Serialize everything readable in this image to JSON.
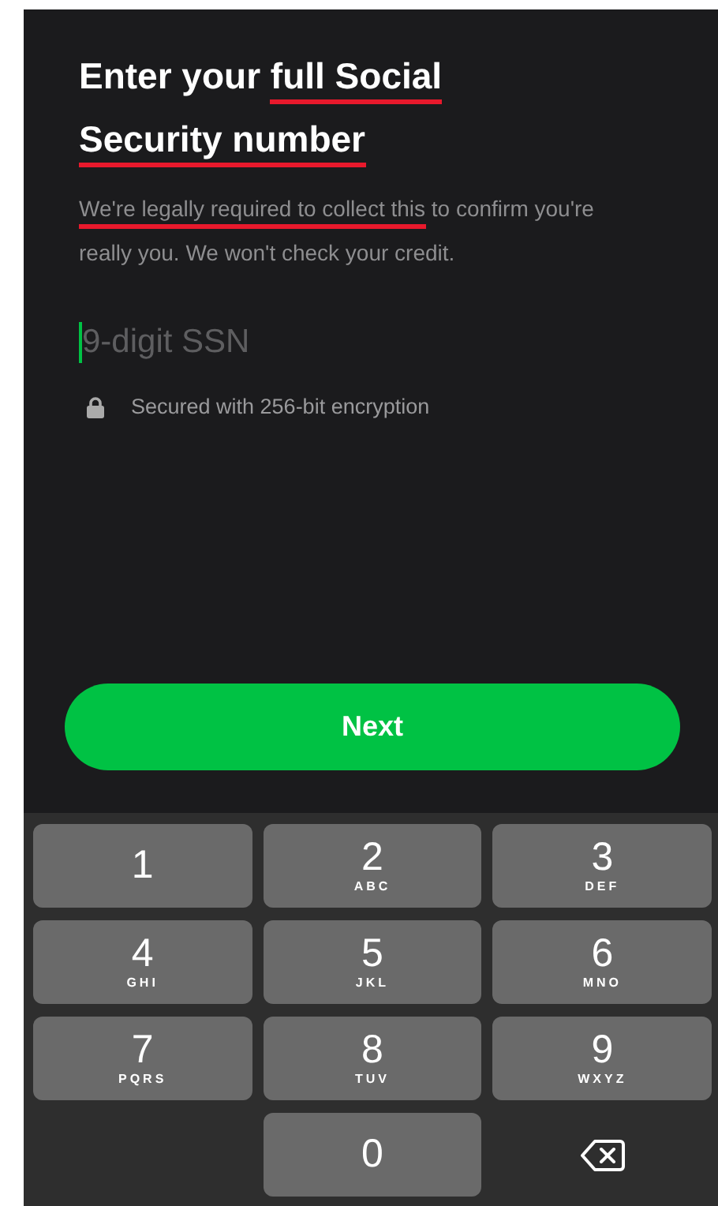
{
  "heading": [
    {
      "text": "Enter your ",
      "marked": false
    },
    {
      "text": "full Social Security number",
      "marked": true
    }
  ],
  "description": [
    {
      "text": "We're legally required to collect this",
      "marked": true
    },
    {
      "text": " to confirm you're really you. We won't check your credit.",
      "marked": false
    }
  ],
  "ssn_field": {
    "placeholder": "9-digit SSN"
  },
  "security_note": "Secured with 256-bit encryption",
  "next_button": "Next",
  "keypad": [
    {
      "kind": "digit",
      "digit": "1"
    },
    {
      "kind": "digit",
      "digit": "2",
      "letters": "ABC"
    },
    {
      "kind": "digit",
      "digit": "3",
      "letters": "DEF"
    },
    {
      "kind": "digit",
      "digit": "4",
      "letters": "GHI"
    },
    {
      "kind": "digit",
      "digit": "5",
      "letters": "JKL"
    },
    {
      "kind": "digit",
      "digit": "6",
      "letters": "MNO"
    },
    {
      "kind": "digit",
      "digit": "7",
      "letters": "PQRS"
    },
    {
      "kind": "digit",
      "digit": "8",
      "letters": "TUV"
    },
    {
      "kind": "digit",
      "digit": "9",
      "letters": "WXYZ"
    },
    {
      "kind": "blank"
    },
    {
      "kind": "digit",
      "digit": "0"
    },
    {
      "kind": "backspace"
    }
  ]
}
